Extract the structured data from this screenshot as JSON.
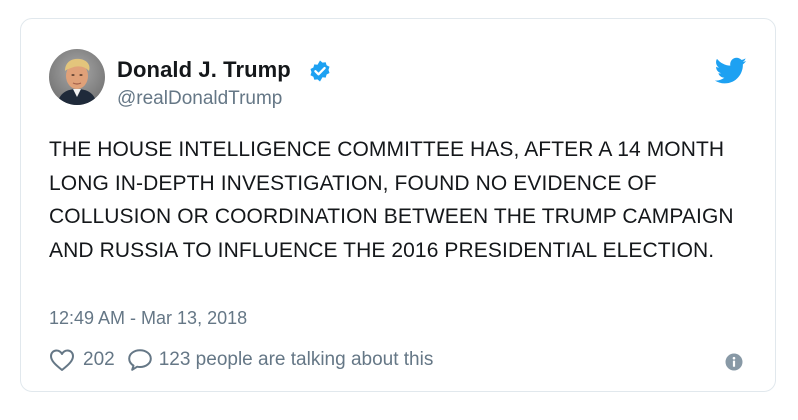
{
  "tweet": {
    "author": {
      "display_name": "Donald J. Trump",
      "handle": "@realDonaldTrump",
      "verified": true
    },
    "text": "THE HOUSE INTELLIGENCE COMMITTEE HAS, AFTER A 14 MONTH LONG IN-DEPTH INVESTIGATION, FOUND NO EVIDENCE OF COLLUSION OR COORDINATION BETWEEN THE TRUMP CAMPAIGN AND RUSSIA TO INFLUENCE THE 2016 PRESIDENTIAL ELECTION.",
    "timestamp": "12:49 AM - Mar 13, 2018",
    "likes": "202",
    "talking_about": "123 people are talking about this"
  },
  "icons": {
    "like": "heart-icon",
    "reply": "speech-bubble-icon",
    "info": "info-icon",
    "verified": "verified-badge-icon",
    "brand": "twitter-bird-icon"
  },
  "colors": {
    "brand_blue": "#1da1f2",
    "text": "#14171a",
    "secondary_text": "#657786",
    "border": "#e1e8ed"
  }
}
